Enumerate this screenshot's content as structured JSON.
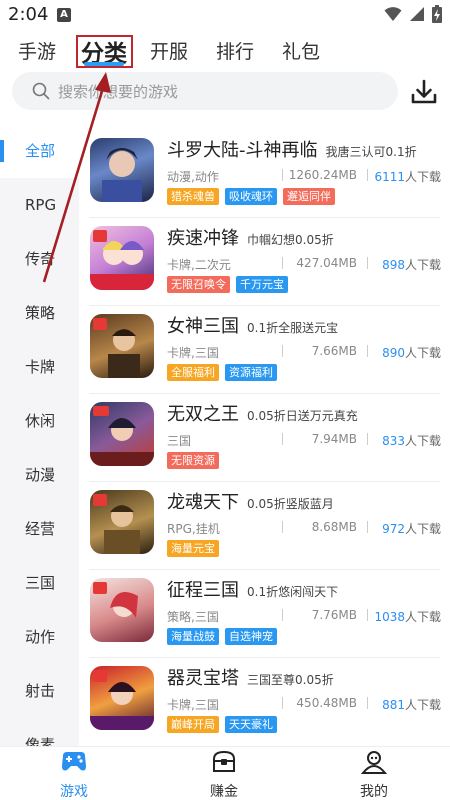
{
  "status": {
    "time": "2:04",
    "notif_badge": "A"
  },
  "top_tabs": [
    "手游",
    "分类",
    "开服",
    "排行",
    "礼包"
  ],
  "search": {
    "placeholder": "搜索你想要的游戏"
  },
  "sidebar": {
    "items": [
      "全部",
      "RPG",
      "传奇",
      "策略",
      "卡牌",
      "休闲",
      "动漫",
      "经营",
      "三国",
      "动作",
      "射击",
      "像素"
    ],
    "active_index": 0
  },
  "games": [
    {
      "name": "斗罗大陆-斗神再临",
      "desc": "我唐三认可0.1折",
      "category": "动漫,动作",
      "size": "1260.24MB",
      "downloads": "6111",
      "dl_suffix": "人下载",
      "tags": [
        {
          "text": "猎杀魂兽",
          "color": "#f6a623"
        },
        {
          "text": "吸收魂环",
          "color": "#2a98f0"
        },
        {
          "text": "邂逅同伴",
          "color": "#f26b5b"
        }
      ]
    },
    {
      "name": "疾速冲锋",
      "desc": "巾帼幻想0.05折",
      "category": "卡牌,二次元",
      "size": "427.04MB",
      "downloads": "898",
      "dl_suffix": "人下载",
      "tags": [
        {
          "text": "无限召唤令",
          "color": "#f26b5b"
        },
        {
          "text": "千万元宝",
          "color": "#2a98f0"
        }
      ]
    },
    {
      "name": "女神三国",
      "desc": "0.1折全服送元宝",
      "category": "卡牌,三国",
      "size": "7.66MB",
      "downloads": "890",
      "dl_suffix": "人下载",
      "tags": [
        {
          "text": "全服福利",
          "color": "#f6a623"
        },
        {
          "text": "资源福利",
          "color": "#2a98f0"
        }
      ]
    },
    {
      "name": "无双之王",
      "desc": "0.05折日送万元真充",
      "category": "三国",
      "size": "7.94MB",
      "downloads": "833",
      "dl_suffix": "人下载",
      "tags": [
        {
          "text": "无限资源",
          "color": "#f26b5b"
        }
      ]
    },
    {
      "name": "龙魂天下",
      "desc": "0.05折竖版蓝月",
      "category": "RPG,挂机",
      "size": "8.68MB",
      "downloads": "972",
      "dl_suffix": "人下载",
      "tags": [
        {
          "text": "海量元宝",
          "color": "#f6a623"
        }
      ]
    },
    {
      "name": "征程三国",
      "desc": "0.1折悠闲闯天下",
      "category": "策略,三国",
      "size": "7.76MB",
      "downloads": "1038",
      "dl_suffix": "人下载",
      "tags": [
        {
          "text": "海量战鼓",
          "color": "#2a98f0"
        },
        {
          "text": "自选神宠",
          "color": "#2a98f0"
        }
      ]
    },
    {
      "name": "器灵宝塔",
      "desc": "三国至尊0.05折",
      "category": "卡牌,三国",
      "size": "450.48MB",
      "downloads": "881",
      "dl_suffix": "人下载",
      "tags": [
        {
          "text": "巅峰开局",
          "color": "#f6a623"
        },
        {
          "text": "天天豪礼",
          "color": "#2a98f0"
        }
      ]
    }
  ],
  "bottom_nav": [
    {
      "label": "游戏",
      "icon": "gamepad-icon",
      "active": true
    },
    {
      "label": "赚金",
      "icon": "treasure-icon",
      "active": false
    },
    {
      "label": "我的",
      "icon": "person-icon",
      "active": false
    }
  ],
  "colors": {
    "accent": "#2b8ff0",
    "highlight": "#c0262d"
  }
}
